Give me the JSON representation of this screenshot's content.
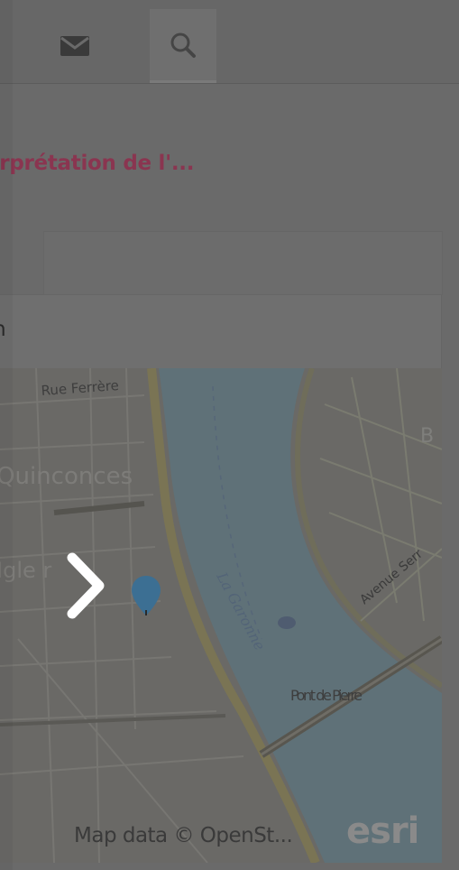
{
  "nav": {
    "mail_icon": "mail-icon",
    "search_icon": "search-icon"
  },
  "page": {
    "title": "erprétation de l'..."
  },
  "form": {
    "field_text": "on"
  },
  "map": {
    "labels": {
      "street": "Rue Ferrère",
      "square": "Quinconces",
      "place_left": "Igle r",
      "river": "La Garonne",
      "road_right": "Avenue Serr",
      "bridge": "Pont de Pierre",
      "edge_letter": "B"
    },
    "attribution": "Map data © OpenSt...",
    "logo": "esri"
  },
  "colors": {
    "title": "#8a3550",
    "river": "#5f7178",
    "marker": "#3c6f93"
  }
}
